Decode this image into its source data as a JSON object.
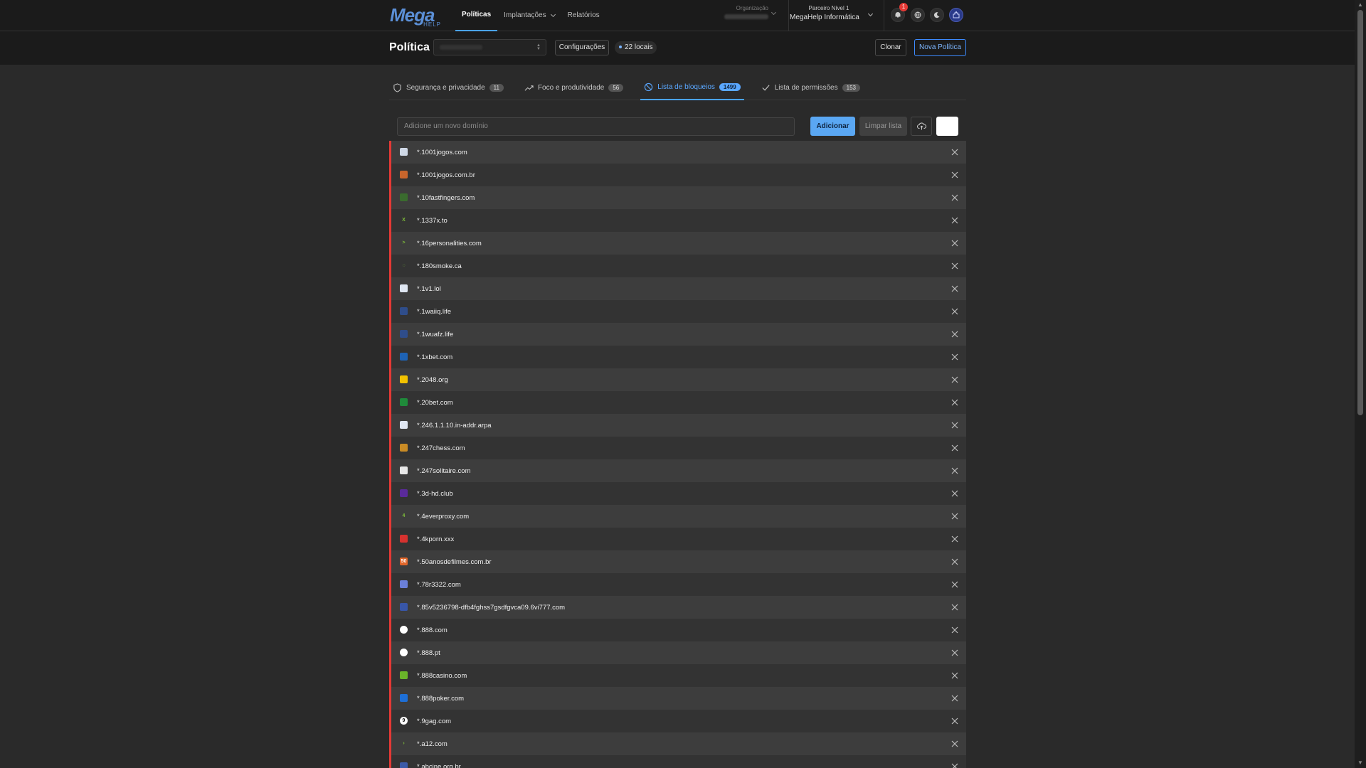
{
  "brand": {
    "logo_main": "Mega",
    "logo_sub": "HELP",
    "accent": "#4aa3ff",
    "danger": "#e53935"
  },
  "nav": {
    "politicas": "Políticas",
    "implantacoes": "Implantações",
    "relatorios": "Relatórios"
  },
  "org": {
    "label": "Organização"
  },
  "partner": {
    "label": "Parceiro Nível 1",
    "name": "MegaHelp Informática"
  },
  "notifications": {
    "count": "1"
  },
  "header": {
    "title": "Política",
    "config_label": "Configurações",
    "locais_label": "22 locais",
    "clone_label": "Clonar",
    "new_policy_label": "Nova Política"
  },
  "tabs": [
    {
      "label": "Segurança e privacidade",
      "count": "11",
      "icon": "shield-icon"
    },
    {
      "label": "Foco e produtividade",
      "count": "56",
      "icon": "trending-up-icon"
    },
    {
      "label": "Lista de bloqueios",
      "count": "1499",
      "icon": "block-icon",
      "active": true
    },
    {
      "label": "Lista de permissões",
      "count": "153",
      "icon": "check-icon"
    }
  ],
  "add_bar": {
    "placeholder": "Adicione um novo domínio",
    "add_label": "Adicionar",
    "clear_label": "Limpar lista"
  },
  "blocklist": [
    {
      "domain": "*.1001jogos.com",
      "fav_color": "#cfd8e6",
      "fav_text": ""
    },
    {
      "domain": "*.1001jogos.com.br",
      "fav_color": "#c8652c",
      "fav_text": ""
    },
    {
      "domain": "*.10fastfingers.com",
      "fav_color": "#3a6b2e",
      "fav_text": ""
    },
    {
      "domain": "*.1337x.to",
      "fav_color": "transparent",
      "fav_text": "X"
    },
    {
      "domain": "*.16personalities.com",
      "fav_color": "transparent",
      "fav_text": ">"
    },
    {
      "domain": "*.180smoke.ca",
      "fav_color": "transparent",
      "fav_text": "◌"
    },
    {
      "domain": "*.1v1.lol",
      "fav_color": "#dfe6f2",
      "fav_text": ""
    },
    {
      "domain": "*.1waiiq.life",
      "fav_color": "#2f4d8a",
      "fav_text": ""
    },
    {
      "domain": "*.1wuafz.life",
      "fav_color": "#2f4d8a",
      "fav_text": ""
    },
    {
      "domain": "*.1xbet.com",
      "fav_color": "#1e63b5",
      "fav_text": ""
    },
    {
      "domain": "*.2048.org",
      "fav_color": "#f2c200",
      "fav_text": ""
    },
    {
      "domain": "*.20bet.com",
      "fav_color": "#1f8a3a",
      "fav_text": ""
    },
    {
      "domain": "*.246.1.1.10.in-addr.arpa",
      "fav_color": "#dfe6f2",
      "fav_text": ""
    },
    {
      "domain": "*.247chess.com",
      "fav_color": "#c98b25",
      "fav_text": ""
    },
    {
      "domain": "*.247solitaire.com",
      "fav_color": "#e8e8e8",
      "fav_text": ""
    },
    {
      "domain": "*.3d-hd.club",
      "fav_color": "#5a2a9a",
      "fav_text": ""
    },
    {
      "domain": "*.4everproxy.com",
      "fav_color": "transparent",
      "fav_text": "4"
    },
    {
      "domain": "*.4kporn.xxx",
      "fav_color": "#d6322f",
      "fav_text": ""
    },
    {
      "domain": "*.50anosdefilmes.com.br",
      "fav_color": "#e0662a",
      "fav_text": "50"
    },
    {
      "domain": "*.78r3322.com",
      "fav_color": "#6a7fd8",
      "fav_text": ""
    },
    {
      "domain": "*.85v5236798-dfb4fghss7gsdfgvca09.6vi777.com",
      "fav_color": "#3856a8",
      "fav_text": ""
    },
    {
      "domain": "*.888.com",
      "fav_color": "#ffffff",
      "fav_text": ""
    },
    {
      "domain": "*.888.pt",
      "fav_color": "#ffffff",
      "fav_text": ""
    },
    {
      "domain": "*.888casino.com",
      "fav_color": "#6ab42a",
      "fav_text": ""
    },
    {
      "domain": "*.888poker.com",
      "fav_color": "#1e6fd6",
      "fav_text": ""
    },
    {
      "domain": "*.9gag.com",
      "fav_color": "#ffffff",
      "fav_text": "9"
    },
    {
      "domain": "*.a12.com",
      "fav_color": "transparent",
      "fav_text": "›"
    },
    {
      "domain": "*.abcine.org.br",
      "fav_color": "#3b5aa8",
      "fav_text": ""
    }
  ]
}
